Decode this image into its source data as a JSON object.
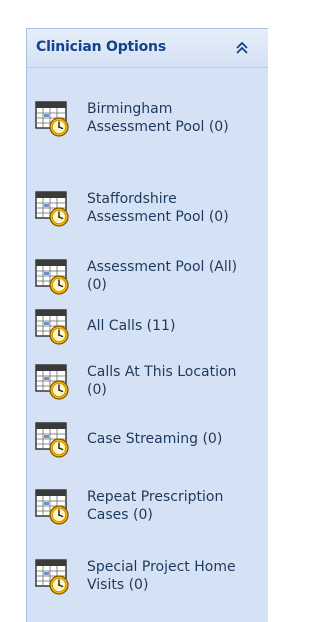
{
  "panel": {
    "title": "Clinician Options",
    "collapse_icon": "double-chevron-up-icon",
    "item_icon": "calendar-clock-icon",
    "items": [
      {
        "label": "Birmingham Assessment Pool (0)"
      },
      {
        "label": "Staffordshire Assessment Pool (0)"
      },
      {
        "label": "Assessment Pool (All) (0)"
      },
      {
        "label": "All Calls (11)"
      },
      {
        "label": "Calls At This Location (0)"
      },
      {
        "label": "Case Streaming (0)"
      },
      {
        "label": "Repeat Prescription Cases (0)"
      },
      {
        "label": "Special Project Home Visits (0)"
      }
    ]
  },
  "colors": {
    "panel_background": "#d5e2f5",
    "title_text": "#15428b",
    "item_text": "#1e395b"
  }
}
